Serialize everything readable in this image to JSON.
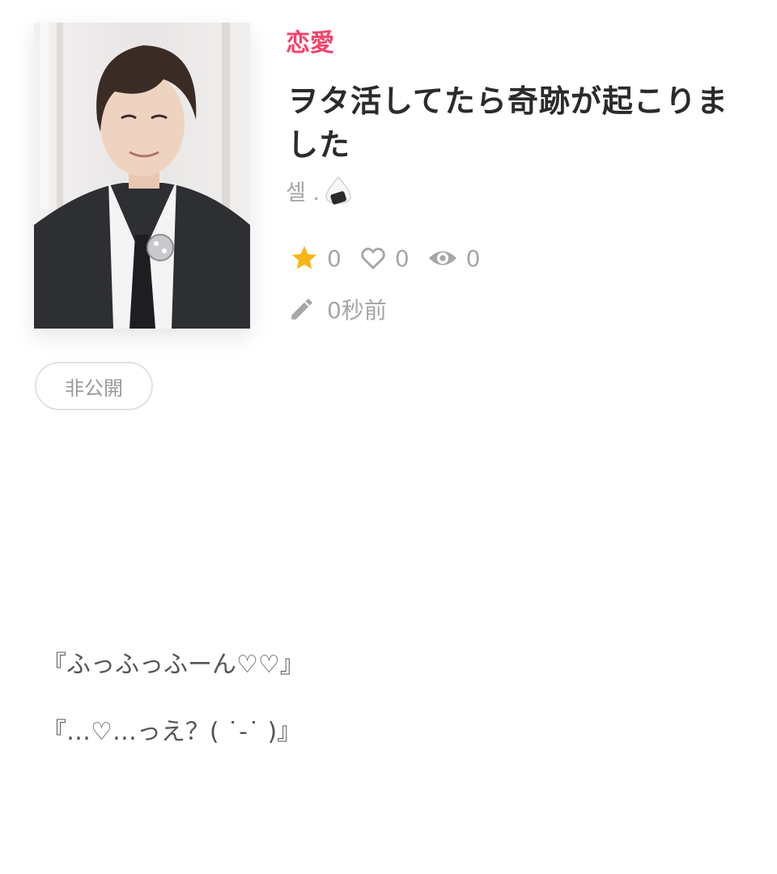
{
  "work": {
    "category": "恋愛",
    "category_color": "#f4436c",
    "title": "ヲタ活してたら奇跡が起こりました",
    "author": "셀 .",
    "author_emoji": "rice-ball-icon",
    "stats": {
      "stars": "0",
      "likes": "0",
      "views": "0"
    },
    "updated": "0秒前",
    "visibility_badge": "非公開",
    "star_color": "#f7b518"
  },
  "body": {
    "lines": [
      "『ふっふっふーん♡♡』",
      "『…♡…っえ？( ˙-˙ )』"
    ]
  }
}
